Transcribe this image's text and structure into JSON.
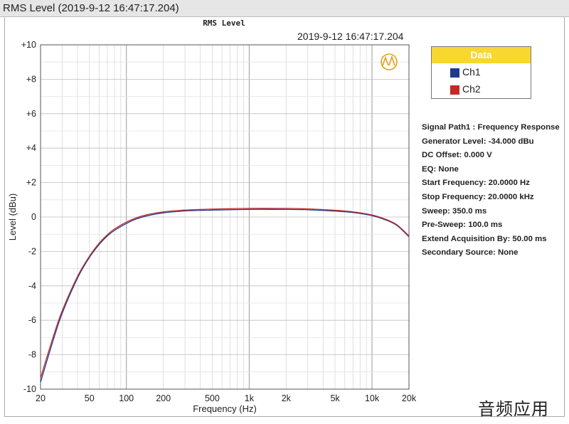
{
  "window": {
    "title": "RMS Level (2019-9-12 16:47:17.204)"
  },
  "chart_heading": "RMS Level",
  "timestamp": "2019-9-12 16:47:17.204",
  "legend": {
    "header": "Data",
    "items": [
      {
        "label": "Ch1",
        "color": "#1f3a8a"
      },
      {
        "label": "Ch2",
        "color": "#c62828"
      }
    ]
  },
  "info_lines": [
    "Signal Path1 : Frequency Response",
    "Generator Level: -34.000 dBu",
    "DC Offset: 0.000 V",
    "EQ: None",
    "Start Frequency: 20.0000 Hz",
    "Stop Frequency: 20.0000 kHz",
    "Sweep: 350.0 ms",
    "Pre-Sweep: 100.0 ms",
    "Extend Acquisition By: 50.00 ms",
    "Secondary Source: None"
  ],
  "watermark": "音频应用",
  "chart_data": {
    "type": "line",
    "xlabel": "Frequency (Hz)",
    "ylabel": "Level (dBu)",
    "xscale": "log",
    "xlim": [
      20,
      20000
    ],
    "ylim": [
      -10,
      10
    ],
    "grid": true,
    "legend_position": "top-right",
    "x_ticks": [
      {
        "value": 20,
        "label": "20"
      },
      {
        "value": 50,
        "label": "50"
      },
      {
        "value": 100,
        "label": "100"
      },
      {
        "value": 200,
        "label": "200"
      },
      {
        "value": 500,
        "label": "500"
      },
      {
        "value": 1000,
        "label": "1k"
      },
      {
        "value": 2000,
        "label": "2k"
      },
      {
        "value": 5000,
        "label": "5k"
      },
      {
        "value": 10000,
        "label": "10k"
      },
      {
        "value": 20000,
        "label": "20k"
      }
    ],
    "y_ticks": [
      {
        "value": 10,
        "label": "+10"
      },
      {
        "value": 8,
        "label": "+8"
      },
      {
        "value": 6,
        "label": "+6"
      },
      {
        "value": 4,
        "label": "+4"
      },
      {
        "value": 2,
        "label": "+2"
      },
      {
        "value": 0,
        "label": "0"
      },
      {
        "value": -2,
        "label": "-2"
      },
      {
        "value": -4,
        "label": "-4"
      },
      {
        "value": -6,
        "label": "-6"
      },
      {
        "value": -8,
        "label": "-8"
      },
      {
        "value": -10,
        "label": "-10"
      }
    ],
    "series": [
      {
        "name": "Ch1",
        "color": "#1f3a8a",
        "x": [
          20,
          25,
          30,
          40,
          50,
          60,
          70,
          80,
          100,
          120,
          150,
          200,
          300,
          500,
          1000,
          2000,
          3000,
          5000,
          7000,
          10000,
          13000,
          16000,
          20000
        ],
        "y": [
          -9.6,
          -7.3,
          -5.6,
          -3.55,
          -2.35,
          -1.6,
          -1.1,
          -0.78,
          -0.38,
          -0.12,
          0.08,
          0.24,
          0.35,
          0.4,
          0.44,
          0.44,
          0.42,
          0.34,
          0.26,
          0.08,
          -0.18,
          -0.5,
          -1.15
        ]
      },
      {
        "name": "Ch2",
        "color": "#c62828",
        "x": [
          20,
          25,
          30,
          40,
          50,
          60,
          70,
          80,
          100,
          120,
          150,
          200,
          300,
          500,
          1000,
          2000,
          3000,
          5000,
          7000,
          10000,
          13000,
          16000,
          20000
        ],
        "y": [
          -9.35,
          -7.1,
          -5.45,
          -3.45,
          -2.28,
          -1.52,
          -1.03,
          -0.7,
          -0.3,
          -0.05,
          0.15,
          0.3,
          0.4,
          0.46,
          0.5,
          0.5,
          0.47,
          0.39,
          0.3,
          0.12,
          -0.14,
          -0.46,
          -1.1
        ]
      }
    ]
  }
}
